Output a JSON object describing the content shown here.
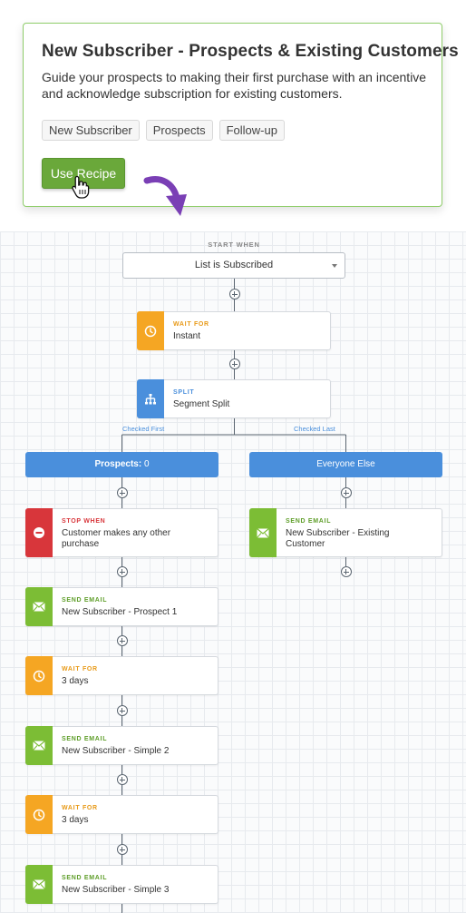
{
  "recipe": {
    "title": "New Subscriber - Prospects & Existing Customers",
    "description": "Guide your prospects to making their first purchase with an incentive and acknowledge subscription for existing customers.",
    "tags": [
      "New Subscriber",
      "Prospects",
      "Follow-up"
    ],
    "use_button": "Use Recipe"
  },
  "colors": {
    "wait": "#f5a623",
    "split": "#4a8fdc",
    "stop": "#d8363b",
    "email": "#7cbd35",
    "card_border": "#8fcd6a",
    "arrow": "#7a3fb5"
  },
  "flow": {
    "start_label": "START WHEN",
    "trigger": "List is Subscribed",
    "steps": [
      {
        "kind": "WAIT FOR",
        "name": "Instant",
        "icon": "clock-icon"
      },
      {
        "kind": "SPLIT",
        "name": "Segment Split",
        "icon": "split-icon"
      }
    ],
    "branch_labels": [
      "Checked First",
      "Checked Last"
    ],
    "left_branch": {
      "title": "Prospects:",
      "count": "0",
      "steps": [
        {
          "kind": "STOP WHEN",
          "name": "Customer makes any other purchase",
          "icon": "stop-icon"
        },
        {
          "kind": "SEND EMAIL",
          "name": "New Subscriber - Prospect 1",
          "icon": "email-icon"
        },
        {
          "kind": "WAIT FOR",
          "name": "3 days",
          "icon": "clock-icon"
        },
        {
          "kind": "SEND EMAIL",
          "name": "New Subscriber - Simple 2",
          "icon": "email-icon"
        },
        {
          "kind": "WAIT FOR",
          "name": "3 days",
          "icon": "clock-icon"
        },
        {
          "kind": "SEND EMAIL",
          "name": "New Subscriber - Simple 3",
          "icon": "email-icon"
        }
      ]
    },
    "right_branch": {
      "title": "Everyone Else",
      "steps": [
        {
          "kind": "SEND EMAIL",
          "name": "New Subscriber - Existing Customer",
          "icon": "email-icon"
        }
      ]
    }
  }
}
